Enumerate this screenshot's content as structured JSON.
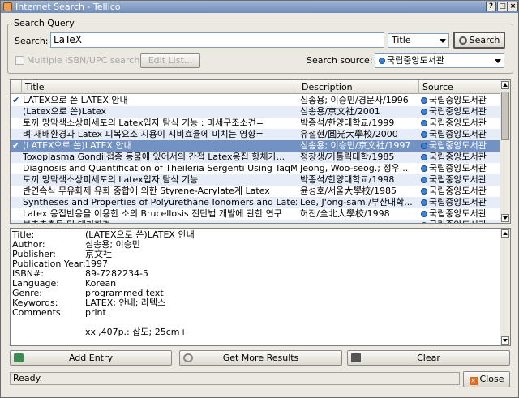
{
  "window": {
    "title": "Internet Search - Tellico",
    "btn_help": "?",
    "btn_max": "□",
    "btn_close": "×"
  },
  "query": {
    "group_label": "Search Query",
    "search_label": "Search:",
    "search_value": "LaTeX",
    "field_select": "Title",
    "search_button": "Search",
    "multi_isbn_label": "Multiple ISBN/UPC search",
    "edit_list_button": "Edit List...",
    "source_label": "Search source:",
    "source_select": "국립중앙도서관"
  },
  "results": {
    "columns": [
      "Title",
      "Description",
      "Source"
    ],
    "rows": [
      {
        "checked": true,
        "title": "LATEX으로 쓴 LATEX 안내",
        "description": "심송용; 이승민/경문사/1996",
        "source": "국립중앙도서관"
      },
      {
        "checked": false,
        "title": "(Latex으로 쓴)Latex",
        "description": "심송용/京文社/2001",
        "source": "국립중앙도서관"
      },
      {
        "checked": false,
        "title": "토끼 망막색소상피세포의 Latex입자 탐식 기능 : 미세구조소견=",
        "description": "박종석/한양대학교/1999",
        "source": "국립중앙도서관"
      },
      {
        "checked": false,
        "title": "벼 재배환경과 Latex 피복요소 시용이 시비효율에 미치는 영향=",
        "description": "유철현/圓光大學校/2000",
        "source": "국립중앙도서관"
      },
      {
        "checked": true,
        "title": "(LATEX으로 쓴)LATEX 안내",
        "description": "심송용; 이승민/京文社/1997",
        "source": "국립중앙도서관",
        "selected": true
      },
      {
        "checked": false,
        "title": "Toxoplasma Gondii접종 동물에 있어서의 간접 Latex응집 항체가...",
        "description": "정창생/가톨릭대학/1985",
        "source": "국립중앙도서관"
      },
      {
        "checked": false,
        "title": "Diagnosis and Quantification of Theileria Sergenti Using TaqMan...",
        "description": "Jeong, Woo-seog.; 정우...",
        "source": "국립중앙도서관"
      },
      {
        "checked": false,
        "title": "토끼 망막색소상피세포의 Latex입자 탐식 기능",
        "description": "박종석/한양대학교/1998",
        "source": "국립중앙도서관"
      },
      {
        "checked": false,
        "title": "반연속식 무유화제 유화 중합에 의한 Styrene-Acrylate계 Latex",
        "description": "윤성호/서울大學校/1985",
        "source": "국립중앙도서관"
      },
      {
        "checked": false,
        "title": "Syntheses and Properties of Polyurethane Ionomers and Latex ...",
        "description": "Lee, J'ong-sam./부산대학...",
        "source": "국립중앙도서관"
      },
      {
        "checked": false,
        "title": "Latex 응집반응을 이용한 소의 Brucellosis 진단법 개발에 관한 연구",
        "description": "허진/全北大學校/1998",
        "source": "국립중앙도서관"
      },
      {
        "checked": false,
        "title": "부추추출물 및 대기환경...",
        "description": "",
        "source": "국립중앙도서관"
      }
    ]
  },
  "detail": [
    {
      "key": "Title:",
      "value": "(LATEX으로 쓴)LATEX 안내"
    },
    {
      "key": "Author:",
      "value": "심송용; 이승민"
    },
    {
      "key": "Publisher:",
      "value": "京文社"
    },
    {
      "key": "Publication Year:",
      "value": "1997"
    },
    {
      "key": "ISBN#:",
      "value": "89-7282234-5"
    },
    {
      "key": "Language:",
      "value": "Korean"
    },
    {
      "key": "Genre:",
      "value": "programmed text"
    },
    {
      "key": "Keywords:",
      "value": "LATEX; 안내; 라텍스"
    },
    {
      "key": "Comments:",
      "value": "print"
    },
    {
      "key": "",
      "value": ""
    },
    {
      "key": "",
      "value": "xxi,407p.: 삽도; 25cm+"
    }
  ],
  "actions": {
    "add_entry": "Add Entry",
    "get_more": "Get More Results",
    "clear": "Clear",
    "close": "Close"
  },
  "status": "Ready."
}
